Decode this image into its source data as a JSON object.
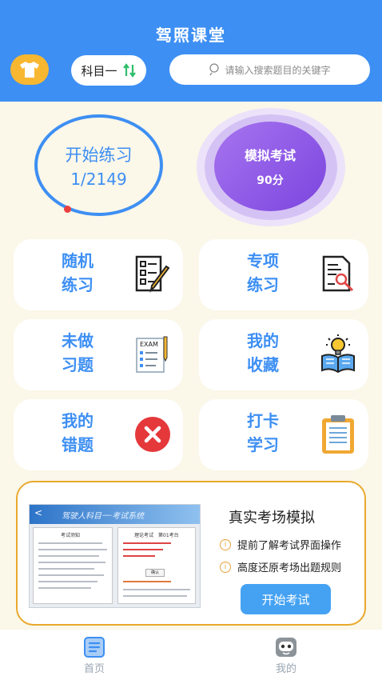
{
  "header": {
    "title": "驾照课堂",
    "subject_label": "科目一",
    "search_placeholder": "请输入搜索题目的关键字"
  },
  "practice": {
    "label": "开始练习",
    "progress": "1/2149"
  },
  "mock_exam": {
    "label": "模拟考试",
    "score": "90分"
  },
  "cards": [
    {
      "line1": "随机",
      "line2": "练习",
      "icon": "checklist-pencil-icon"
    },
    {
      "line1": "专项",
      "line2": "练习",
      "icon": "document-magnifier-icon"
    },
    {
      "line1": "未做",
      "line2": "习题",
      "icon": "exam-paper-icon"
    },
    {
      "line1": "我的",
      "line2": "收藏",
      "icon": "book-lightbulb-icon"
    },
    {
      "line1": "我的",
      "line2": "错题",
      "icon": "red-x-icon"
    },
    {
      "line1": "打卡",
      "line2": "学习",
      "icon": "clipboard-icon"
    }
  ],
  "simulation": {
    "title": "真实考场模拟",
    "features": [
      "提前了解考试界面操作",
      "高度还原考场出题规则"
    ],
    "button": "开始考试",
    "screenshot": {
      "system_title": "驾驶人科目一·考试系统",
      "notice_title": "考试须知",
      "exam_title": "理论考试　第01考台",
      "confirm": "确认"
    }
  },
  "tabs": [
    {
      "label": "首页",
      "icon": "home-list-icon"
    },
    {
      "label": "我的",
      "icon": "robot-avatar-icon"
    }
  ],
  "colors": {
    "primary": "#3d8ff3",
    "accent": "#f7b731",
    "purple": "#7b45de",
    "danger": "#ec3f3f"
  }
}
